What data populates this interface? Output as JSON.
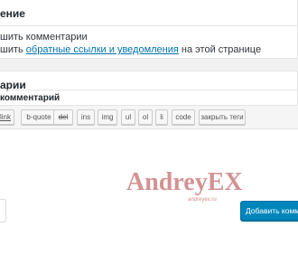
{
  "discussion": {
    "title": "ение",
    "option1": "шить комментарии",
    "option2_prefix": "шить ",
    "option2_link": "обратные ссылки и уведомления",
    "option2_suffix": " на этой странице"
  },
  "comments": {
    "title": "арии",
    "subtitle": "комментарий",
    "toolbar": [
      "link",
      "b-quote",
      "del",
      "ins",
      "img",
      "ul",
      "ol",
      "li",
      "code",
      "закрыть теги"
    ],
    "submit_label": "Добавить комме"
  },
  "watermark": {
    "text": "AndreyEX",
    "url": "andreyex.ru",
    "color": "#b03a3a"
  }
}
